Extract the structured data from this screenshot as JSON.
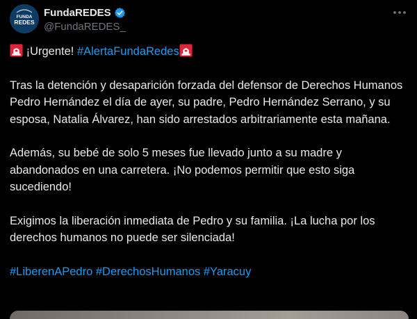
{
  "account": {
    "display_name": "FundaREDES",
    "handle": "@FundaREDES_",
    "avatar_text_top": "FUNDA",
    "avatar_text_bottom": "REDES",
    "verified_icon": "verified-badge-icon",
    "brand_color": "#0e3b66"
  },
  "menu": {
    "icon": "more-horizontal-icon"
  },
  "tweet": {
    "urgent_text": " ¡Urgente! ",
    "alert_hashtag": "#AlertaFundaRedes",
    "emoji_icon": "police-siren-icon",
    "paragraph_1": "Tras la detención y desaparición forzada del defensor de Derechos Humanos Pedro Hernández el día de ayer, su padre, Pedro Hernández Serrano, y su esposa, Natalia Álvarez, han sido arrestados arbitrariamente esta mañana.",
    "paragraph_2": "Además, su bebé de solo 5 meses fue llevado junto a su madre y abandonados en una carretera. ¡No podemos permitir que esto siga sucediendo!",
    "paragraph_3": "Exigimos la liberación inmediata de Pedro y su familia. ¡La lucha por los derechos humanos no puede ser silenciada!",
    "hashtags": [
      "#LiberenAPedro",
      "#DerechosHumanos",
      "#Yaracuy"
    ]
  },
  "colors": {
    "background": "#000000",
    "text": "#e7e9ea",
    "secondary_text": "#71767b",
    "link": "#1d9bf0",
    "verified": "#1d9bf0",
    "siren_red": "#e0243a"
  }
}
